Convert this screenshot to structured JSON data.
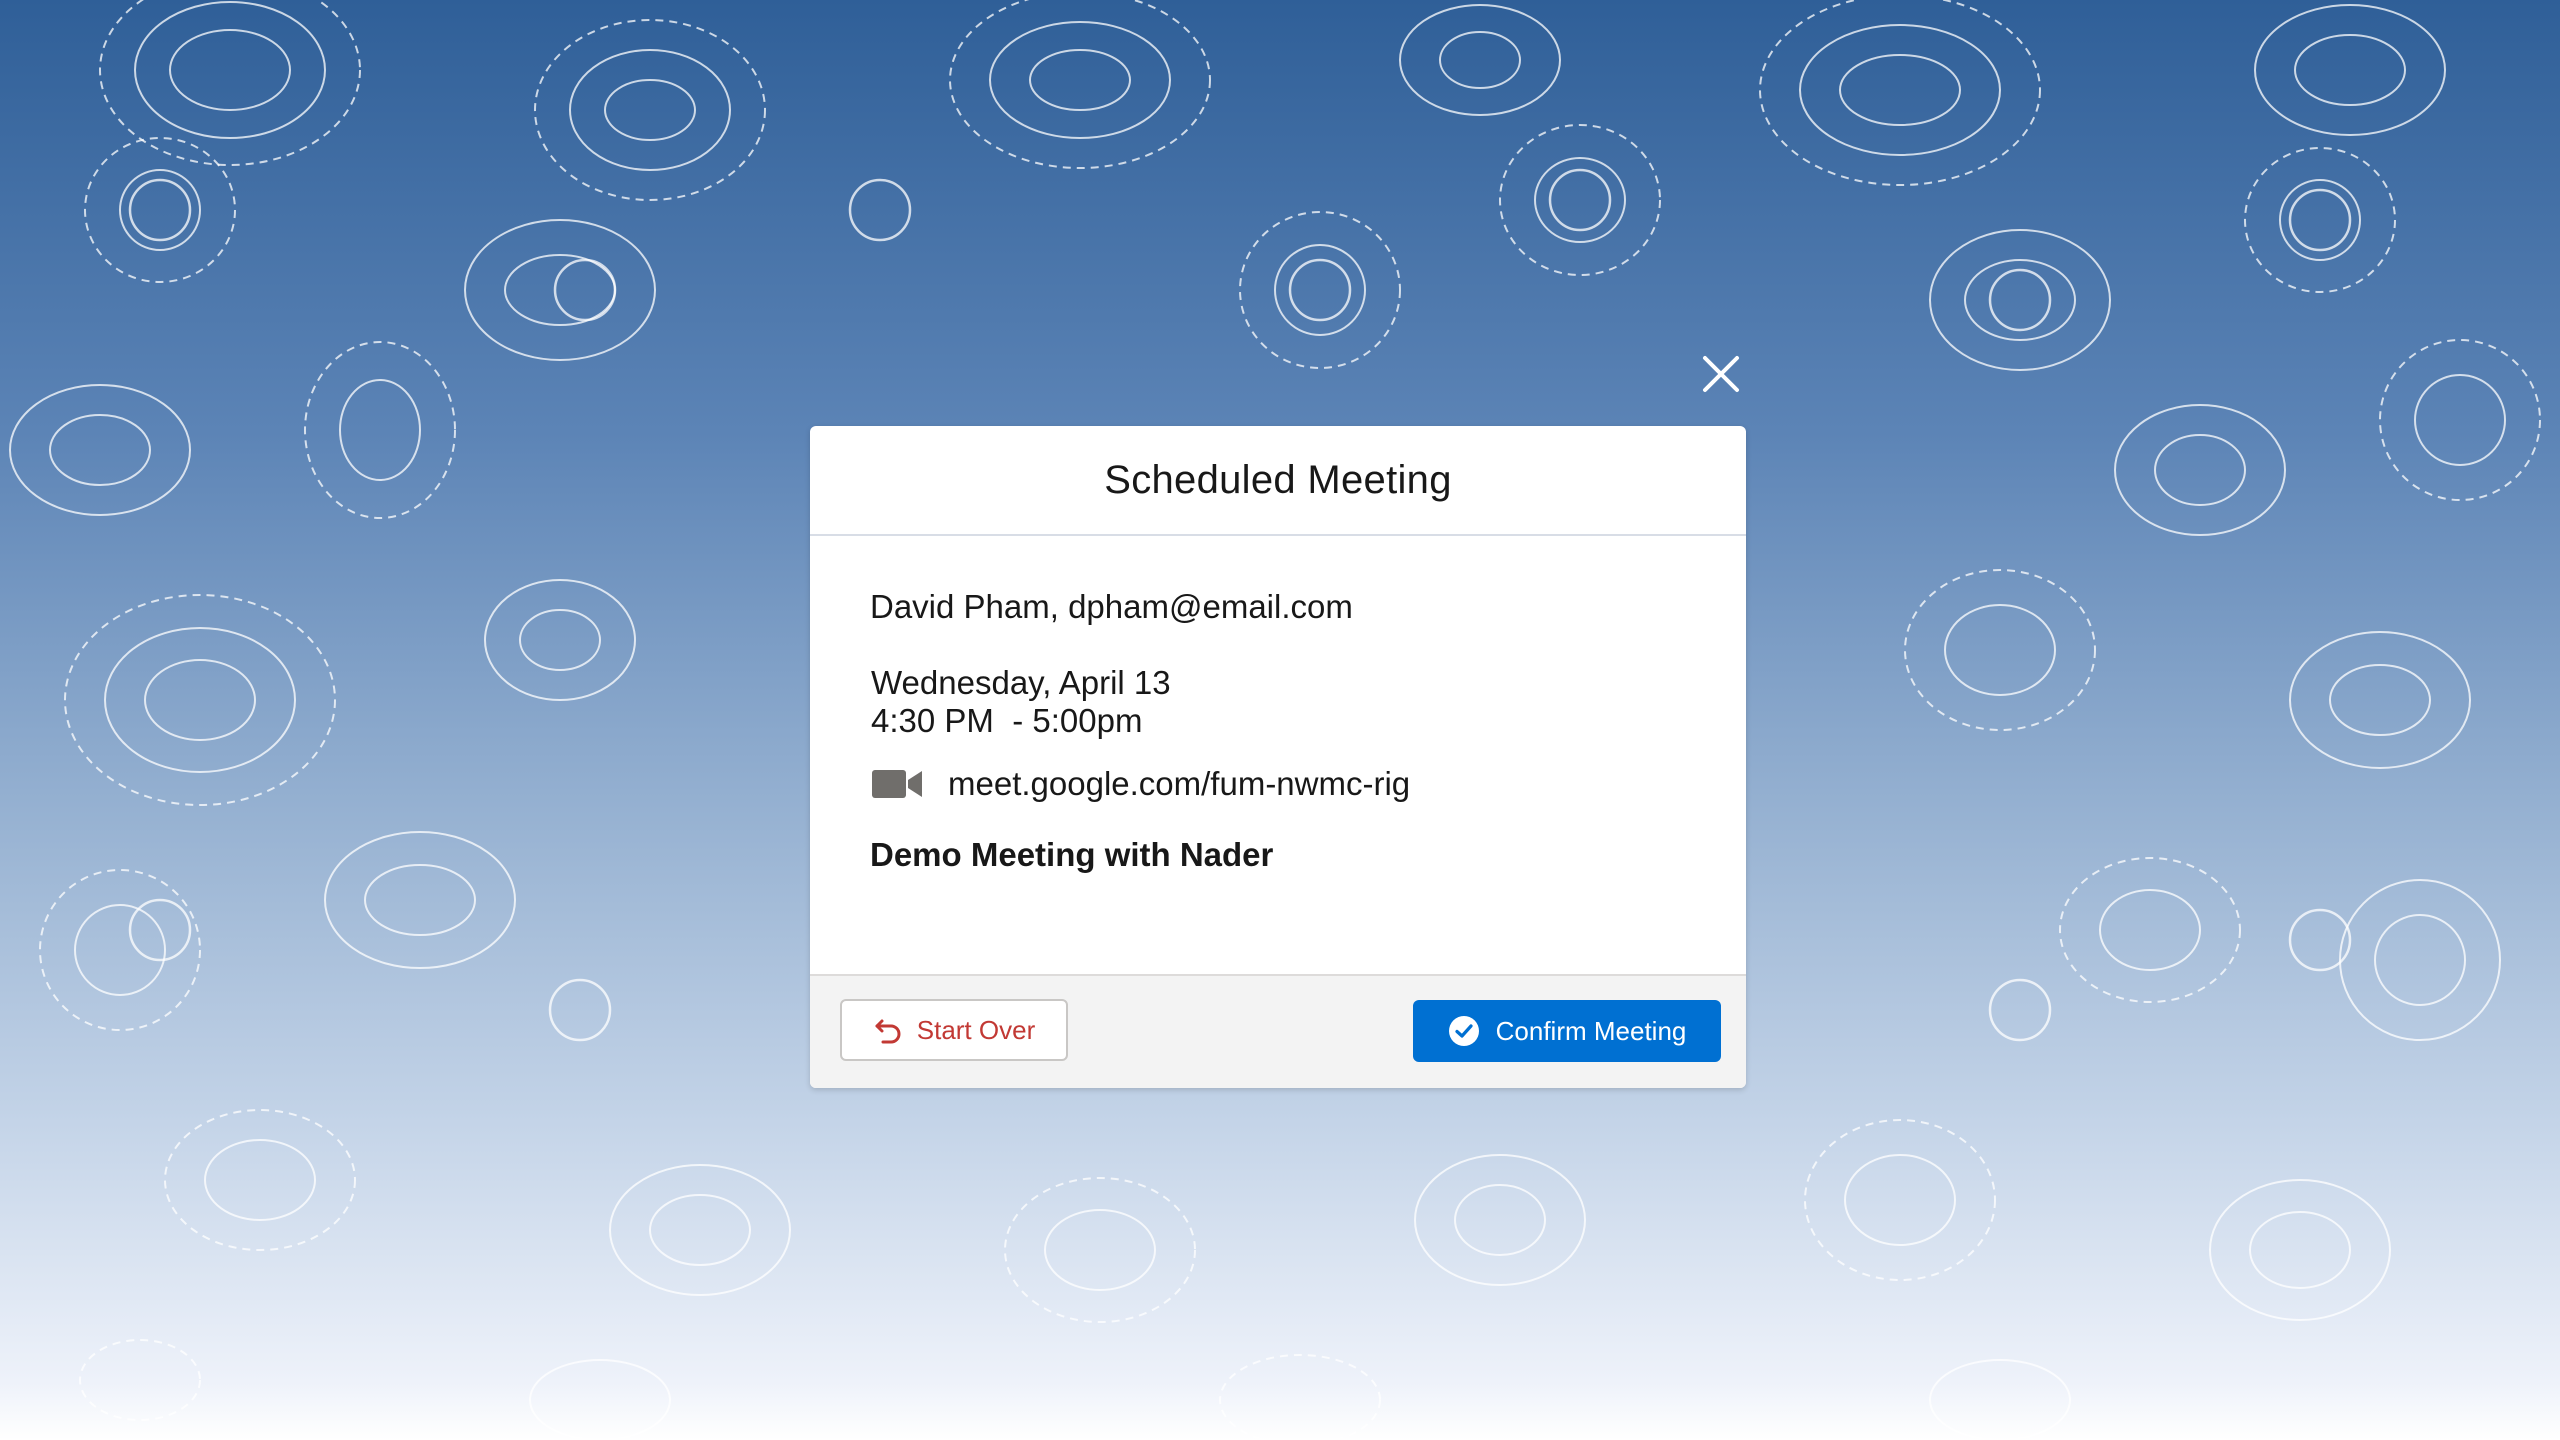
{
  "modal": {
    "title": "Scheduled Meeting",
    "attendee": "David Pham, dpham@email.com",
    "date": "Wednesday, April 13",
    "time": "4:30 PM  - 5:00pm",
    "meeting_link": "meet.google.com/fum-nwmc-rig",
    "subject": "Demo Meeting with Nader"
  },
  "footer": {
    "start_over_label": "Start Over",
    "confirm_label": "Confirm Meeting"
  },
  "icons": {
    "close": "close-icon",
    "video": "video-camera-icon",
    "undo": "undo-icon",
    "check": "check-circle-icon"
  },
  "colors": {
    "brand_blue": "#0070d2",
    "danger_red": "#c23934",
    "icon_gray": "#706e6b"
  }
}
